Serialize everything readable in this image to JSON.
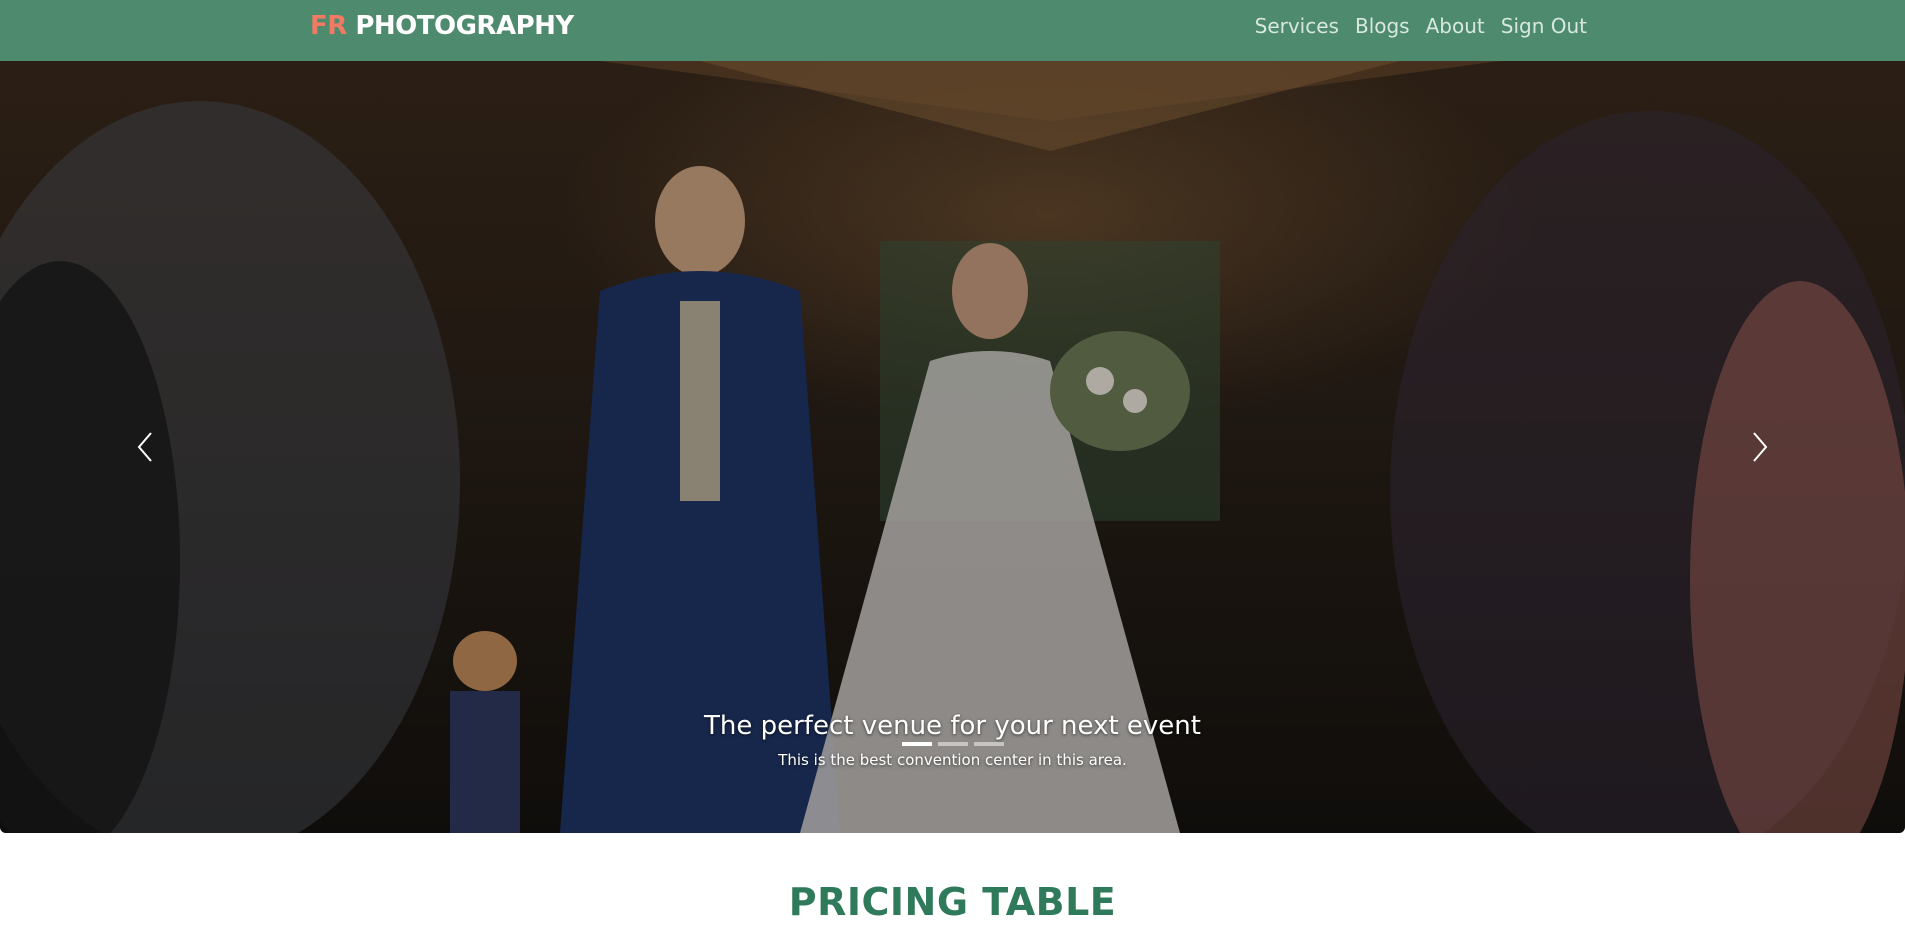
{
  "navbar": {
    "brand_accent": "FR",
    "brand_main": " PHOTOGRAPHY",
    "links": [
      {
        "label": "Services"
      },
      {
        "label": "Blogs"
      },
      {
        "label": "About"
      },
      {
        "label": "Sign Out"
      }
    ],
    "background_color": "#4e8a6e",
    "accent_color": "#f07a63"
  },
  "carousel": {
    "caption_title": "The perfect venue for your next event",
    "caption_text": "This is the best convention center in this area.",
    "prev_icon": "chevron-left-icon",
    "next_icon": "chevron-right-icon",
    "indicators": [
      {
        "active": true
      },
      {
        "active": false
      },
      {
        "active": false
      }
    ]
  },
  "pricing": {
    "title": "PRICING TABLE",
    "title_color": "#2f7a5a"
  }
}
